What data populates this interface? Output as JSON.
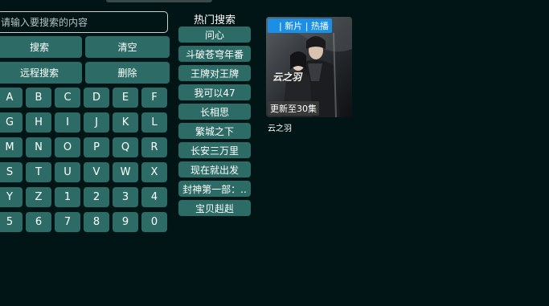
{
  "search": {
    "placeholder": "请输入要搜索的内容",
    "value": ""
  },
  "actions": {
    "search_label": "搜索",
    "clear_label": "清空",
    "remote_search_label": "远程搜索",
    "delete_label": "删除"
  },
  "keyboard": {
    "keys": [
      "A",
      "B",
      "C",
      "D",
      "E",
      "F",
      "G",
      "H",
      "I",
      "J",
      "K",
      "L",
      "M",
      "N",
      "O",
      "P",
      "Q",
      "R",
      "S",
      "T",
      "U",
      "V",
      "W",
      "X",
      "Y",
      "Z",
      "1",
      "2",
      "3",
      "4",
      "5",
      "6",
      "7",
      "8",
      "9",
      "0"
    ]
  },
  "hot": {
    "title": "热门搜索",
    "items": [
      "问心",
      "斗破苍穹年番",
      "王牌对王牌",
      "我可以47",
      "长相思",
      "繁城之下",
      "长安三万里",
      "现在就出发",
      "封神第一部：..",
      "宝贝赳赳"
    ]
  },
  "results": [
    {
      "title": "云之羽",
      "poster_title": "云之羽",
      "tag": "| 新片 | 热播",
      "update": "更新至30集"
    }
  ],
  "colors": {
    "background": "#021516",
    "button": "#2d6c66",
    "tag": "#1b8fe6"
  }
}
